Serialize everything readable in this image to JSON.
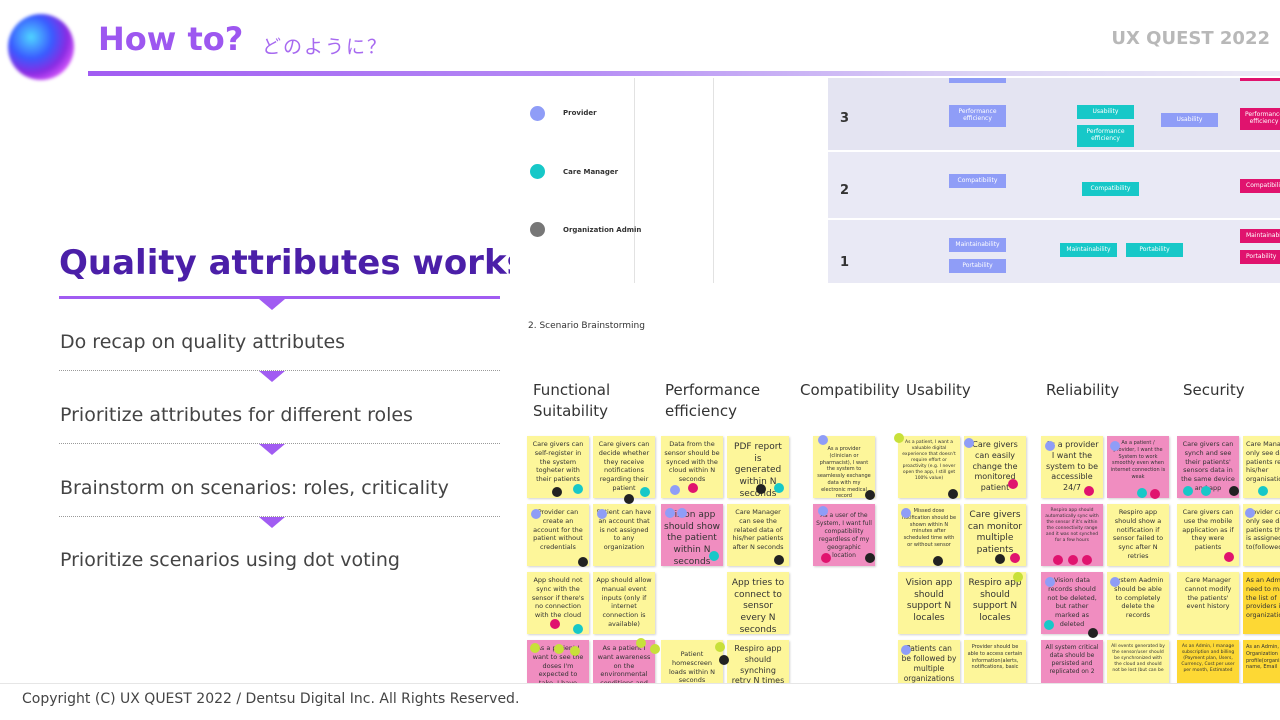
{
  "header": {
    "title": "How to?",
    "subtitle": "どのように？",
    "brand": "UX QUEST 2022"
  },
  "workshop": {
    "title": "Quality attributes workshop",
    "steps": [
      "Do recap on quality attributes",
      "Prioritize attributes for different roles",
      "Brainstorm on scenarios: roles, criticality",
      "Prioritize scenarios using dot voting"
    ]
  },
  "board": {
    "roles": [
      "Provider",
      "Care Manager",
      "Organization Admin"
    ],
    "matrix": {
      "rows": [
        "3",
        "2",
        "1"
      ],
      "tags": {
        "row3": [
          "Performance efficiency",
          "Usability",
          "Performance efficiency",
          "Usability",
          "Performance efficiency"
        ],
        "row2": [
          "Compatibility",
          "Compatibility",
          "Compatibility"
        ],
        "row1": [
          "Maintainability",
          "Portability",
          "Maintainability",
          "Portability",
          "Maintainability",
          "Portability"
        ]
      }
    },
    "section_label": "2.  Scenario Brainstorming",
    "columns": [
      "Functional Suitability",
      "Performance efficiency",
      "Compatibility",
      "Usability",
      "Reliability",
      "Security"
    ],
    "notes": {
      "c1": [
        "Care givers can self-register in the system togheter with their patients",
        "Provider can create an account for the patient without credentials",
        "App should not sync with the sensor if there's no connection with the cloud",
        "As a patient I want to see the doses I'm expected to take, I have"
      ],
      "c2": [
        "Care givers can decide whether they receive notifications regarding their patient",
        "Patient can have an account that is not assigned to any organization",
        "App should allow manual event inputs (only if internet connection is available)",
        "As a patient I want awareness on the environmental conditions and their"
      ],
      "c3": [
        "Data from the sensor should be synced with the cloud within N seconds",
        "Vision app should show the patient within N seconds",
        "Patient homescreen loads within N seconds"
      ],
      "c4": [
        "PDF report is generated within N seconds",
        "Care Manager can see the related data of his/her patients after N seconds",
        "App tries to connect to sensor every N seconds",
        "Respiro app should synching retry N times after a"
      ],
      "c5": [
        "As a provider (clinician or pharmacist), I want the system to seamlessly exchange data with my electronic medical record",
        "As a user of the System, I want full compatibility regardless of my geographic location"
      ],
      "c6": [
        "As a patient, I want a valuable digital experience that doesn't require effort or proactivity (e.g. I never open the app, I still get 100% value)",
        "Missed dose notification should be shown within N minutes after scheduled time with or without sensor",
        "Vision app should support N locales",
        "Patients can be followed by multiple organizations"
      ],
      "c7": [
        "Care givers can easily change the monitored patient",
        "Care givers can monitor multiple patients",
        "Respiro app should support N locales",
        "Provider should be able to access certain information(alerts, notifications, basic"
      ],
      "c8": [
        "As a provider I want the system to be accessible 24/7",
        "Respiro app should automatically sync with the sensor if it's within the connectivity range and it was not synched for a few hours",
        "Vision data records should not be deleted, but rather marked as deleted",
        "All system critical data should be persisted and replicated on 2"
      ],
      "c9": [
        "As a patient / provider, I want the System to work smoothly even when internet connection is weak",
        "Respiro app should show a notification if sensor failed to sync after N retries",
        "System Aadmin should be able to completely delete the records",
        "All events generated by the sensor/user should be synchronized with the cloud and should not be lost (but can be"
      ],
      "c10": [
        "Care givers can synch and see their patients' sensors data in the same device and app",
        "Care givers can use the mobile application as if they were patients",
        "Care Manager cannot modify the patients' event history",
        "As an Admin, I manage subscription and billing (Payment plan, Users, Currency, Cost per user per month, Estimated"
      ],
      "c11": [
        "Care Manager only see data of patients relating his/her organisation",
        "Provider can only see data of patients that he is assigned to(followed)",
        "As an Admin I need to manage the list of providers in my organization",
        "As an Admin, the Organization profile(organization name, Email"
      ]
    }
  },
  "footer": {
    "copyright": "Copyright (C) UX QUEST 2022 / Dentsu Digital Inc. All Rights Reserved."
  },
  "colors": {
    "accent": "#a15cf2",
    "heading": "#4b1fa8",
    "sticky_yellow": "#fdf69a",
    "sticky_pink": "#f08dc0",
    "sticky_orange": "#fdd834"
  }
}
